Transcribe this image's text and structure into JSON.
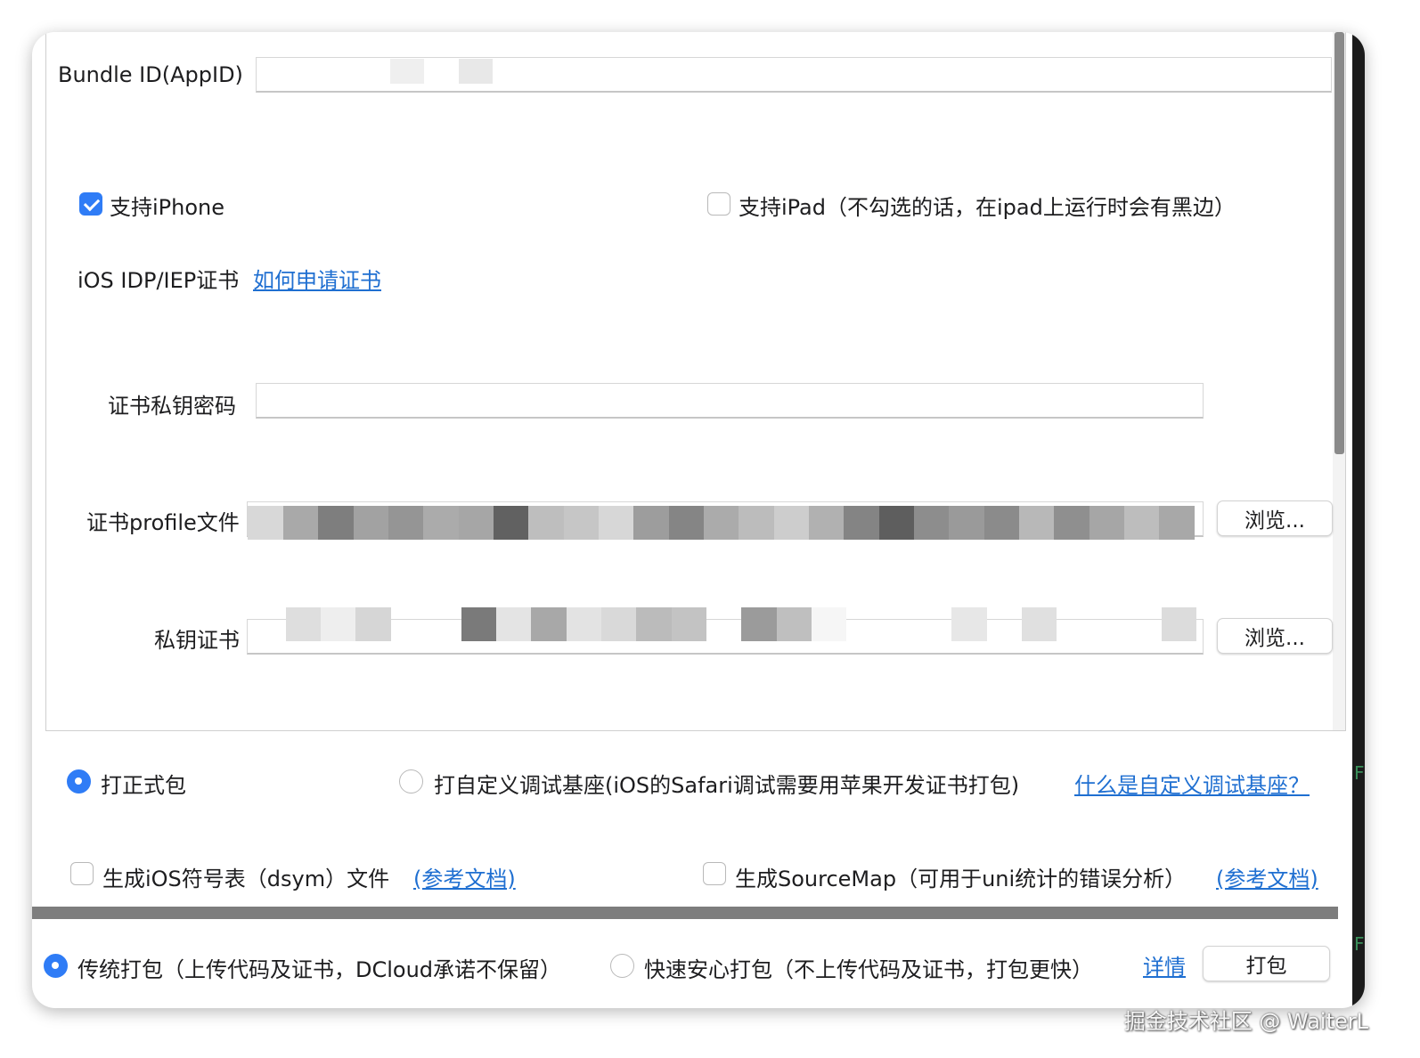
{
  "form": {
    "bundle_id_label": "Bundle ID(AppID)",
    "bundle_id_value": "",
    "support_iphone_label": "支持iPhone",
    "support_iphone_checked": true,
    "support_ipad_label": "支持iPad（不勾选的话，在ipad上运行时会有黑边）",
    "support_ipad_checked": false,
    "cert_label": "iOS IDP/IEP证书",
    "cert_help_link": "如何申请证书",
    "private_key_password_label": "证书私钥密码",
    "private_key_password_value": "",
    "profile_file_label": "证书profile文件",
    "profile_browse_label": "浏览...",
    "private_key_cert_label": "私钥证书",
    "private_key_browse_label": "浏览..."
  },
  "package_mode": {
    "release_label": "打正式包",
    "custom_debug_label": "打自定义调试基座(iOS的Safari调试需要用苹果开发证书打包)",
    "custom_debug_link": "什么是自定义调试基座？",
    "selected": "release"
  },
  "options": {
    "dsym_label": "生成iOS符号表（dsym）文件",
    "dsym_doc_link": "(参考文档)",
    "sourcemap_label": "生成SourceMap（可用于uni统计的错误分析）",
    "sourcemap_doc_link": "(参考文档)"
  },
  "footer": {
    "traditional_label": "传统打包（上传代码及证书，DCloud承诺不保留）",
    "fast_label": "快速安心打包（不上传代码及证书，打包更快）",
    "details_link": "详情",
    "package_button": "打包",
    "selected": "traditional"
  },
  "watermark": "掘金技术社区 @ WaiterL",
  "colors": {
    "accent": "#2f7cf6",
    "link": "#1f6fd1"
  }
}
